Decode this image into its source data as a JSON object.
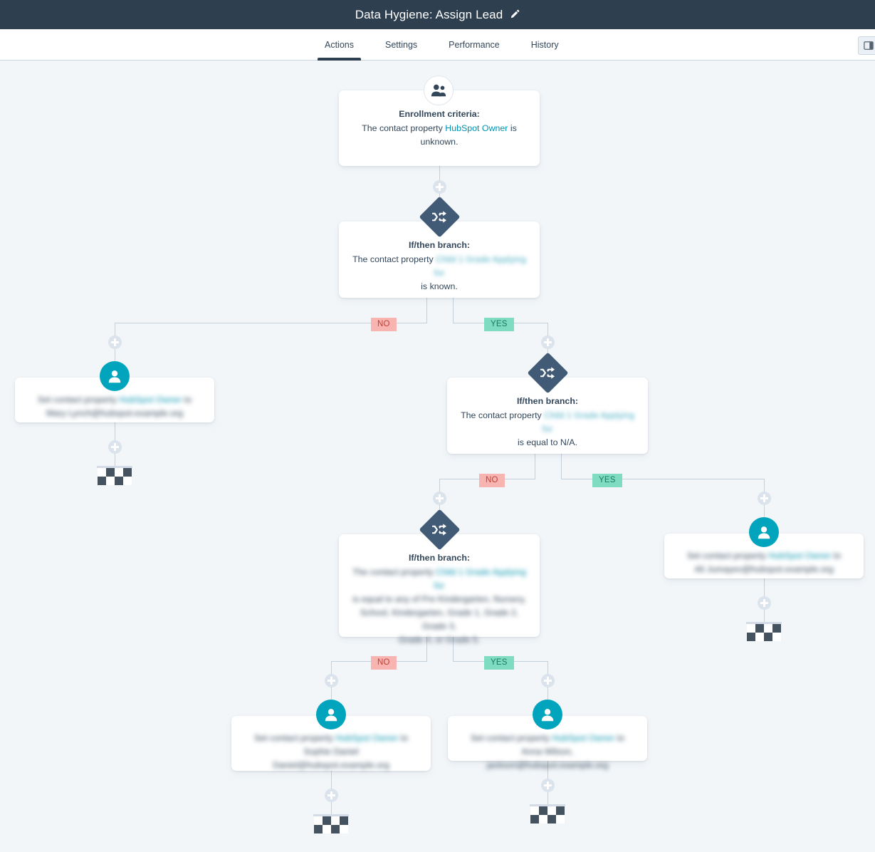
{
  "header": {
    "title": "Data Hygiene: Assign Lead",
    "edit_icon": "pencil-icon"
  },
  "tabs": [
    {
      "label": "Actions",
      "active": true
    },
    {
      "label": "Settings",
      "active": false
    },
    {
      "label": "Performance",
      "active": false
    },
    {
      "label": "History",
      "active": false
    }
  ],
  "header_right": {
    "icon": "panel-toggle-icon"
  },
  "badges": {
    "no": "NO",
    "yes": "YES"
  },
  "nodes": {
    "enrollment": {
      "icon": "contacts-icon",
      "title": "Enrollment criteria:",
      "text_before": "The contact property ",
      "property": "HubSpot Owner",
      "text_after": " is unknown."
    },
    "branch1": {
      "icon": "shuffle-icon",
      "title": "If/then branch:",
      "text_before": "The contact property ",
      "property": "Child 1 Grade Applying for",
      "text_after": "is known."
    },
    "branch2": {
      "icon": "shuffle-icon",
      "title": "If/then branch:",
      "text_before": "The contact property ",
      "property": "Child 1 Grade Applying for",
      "text_after": "is equal to N/A."
    },
    "branch3": {
      "icon": "shuffle-icon",
      "title": "If/then branch:",
      "line1_before": "The contact property ",
      "line1_property": "Child 1 Grade Applying for",
      "line2": "is equal to any of Pre Kindergarten, Nursery,",
      "line3": "School, Kindergarten, Grade 1, Grade 2, Grade 3,",
      "line4": "Grade 4, or Grade 5."
    },
    "action_left": {
      "icon": "person-icon",
      "line1_before": "Set contact property ",
      "line1_property": "HubSpot Owner",
      "line1_after": " to ",
      "line2": "Mary Lynch@hubspot.example.org"
    },
    "action_right": {
      "icon": "person-icon",
      "line1_before": "Set contact property ",
      "line1_property": "HubSpot Owner",
      "line1_after": " to ",
      "line2": "Ali Jumayev@hubspot.example.org"
    },
    "action_bottom_left": {
      "icon": "person-icon",
      "line1_before": "Set contact property ",
      "line1_property": "HubSpot Owner",
      "line1_after": " to",
      "line2": "Sophie Daniel",
      "line3": "Daniel@hubspot.example.org"
    },
    "action_bottom_right": {
      "icon": "person-icon",
      "line1_before": "Set contact property ",
      "line1_property": "HubSpot Owner",
      "line1_after": " to",
      "line2": "Anna Wilson, jackson@hubspot.example.org"
    }
  },
  "end_nodes": {
    "icon": "checkered-flag-icon",
    "count": 4
  },
  "colors": {
    "header_bg": "#2e3f50",
    "canvas_bg": "#f2f6f9",
    "accent_teal": "#00a4bd",
    "link": "#0091ae",
    "diamond": "#415a75",
    "badge_no_bg": "#f8b4b0",
    "badge_yes_bg": "#7fdcc0",
    "connector": "#c3d0de"
  }
}
